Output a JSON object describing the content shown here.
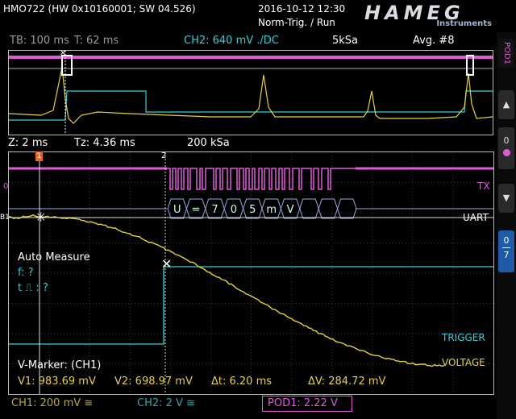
{
  "header": {
    "device": "HMO722 (HW 0x10160001; SW 04.526)",
    "datetime": "2016-10-12 12:30",
    "trigger_state": "Norm-Trig. / Run",
    "logo_word": "HAMEG",
    "logo_sub": "Instruments"
  },
  "topbar": {
    "tb": "TB: 100 ms",
    "t": "T: 62 ms",
    "ch2": "CH2: 640 mV ./DC",
    "sample_rate": "5kSa",
    "avg": "Avg. #8"
  },
  "zoombar": {
    "z": "Z: 2 ms",
    "tz": "Tz: 4.36 ms",
    "sample_rate": "200 kSa"
  },
  "sidebar": {
    "pod_label": "POD1",
    "up_icon": "▲",
    "zero": "0",
    "down_icon": "▼",
    "range_top": "0",
    "range_bottom": "7"
  },
  "plot_labels": {
    "tx": "TX",
    "uart": "UART",
    "trigger": "TRIGGER",
    "voltage": "VOLTAGE",
    "marker_1": "1",
    "marker_2": "2",
    "ch0": "0",
    "b1": "B1",
    "decode": [
      "U",
      "=",
      "7",
      "0",
      "5",
      "m",
      "V",
      "",
      "",
      ""
    ]
  },
  "auto_measure": {
    "title": "Auto Measure",
    "f": "f: ?",
    "t": "t ⎍ : ?"
  },
  "vmarker": {
    "title": "V-Marker: (CH1)",
    "v1": "V1: 983.69 mV",
    "v2": "V2: 698.97 mV",
    "dt": "Δt: 6.20 ms",
    "dv": "ΔV: 284.72 mV"
  },
  "bottom": {
    "ch1": "CH1: 200 mV ≅",
    "ch2": "CH2: 2 V ≅",
    "pod1": "POD1: 2.22 V"
  },
  "colors": {
    "ch1": "#e6d23a",
    "ch2": "#35d0d8",
    "pod": "#e05bd8",
    "grid": "#3a3a3a"
  }
}
